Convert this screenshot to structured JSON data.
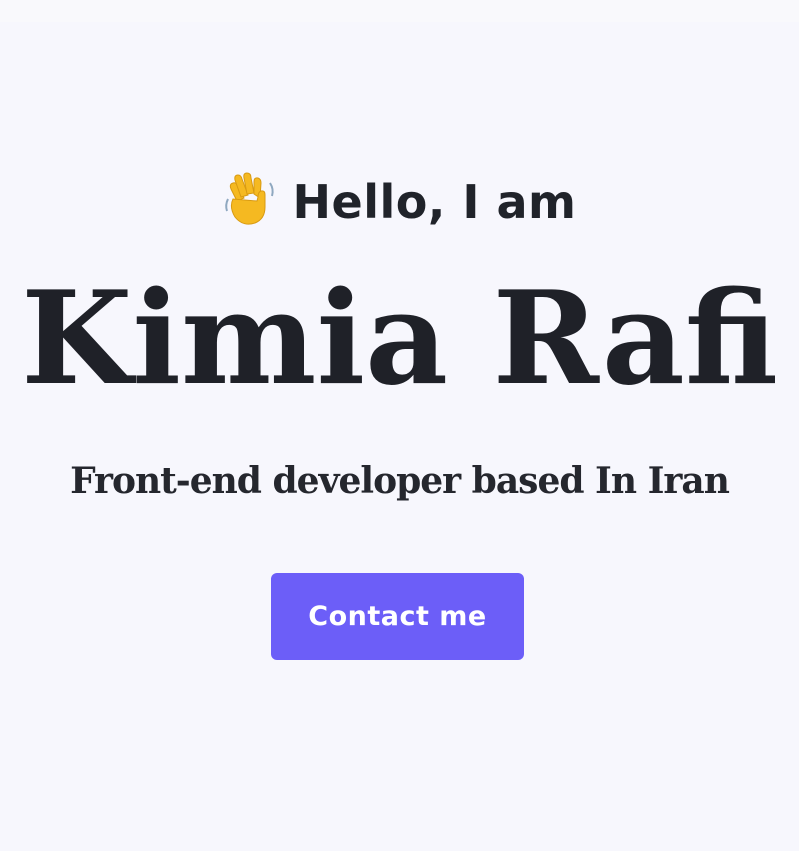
{
  "hero": {
    "greeting_icon": "waving-hand-icon",
    "greeting": "Hello, I am",
    "name": "Kimia Rafi",
    "subtitle": "Front-end developer based In Iran",
    "cta_label": "Contact me"
  },
  "colors": {
    "background": "#f7f7fd",
    "text": "#1f2128",
    "accent": "#6c5ef8",
    "wave": "#f5b921"
  }
}
